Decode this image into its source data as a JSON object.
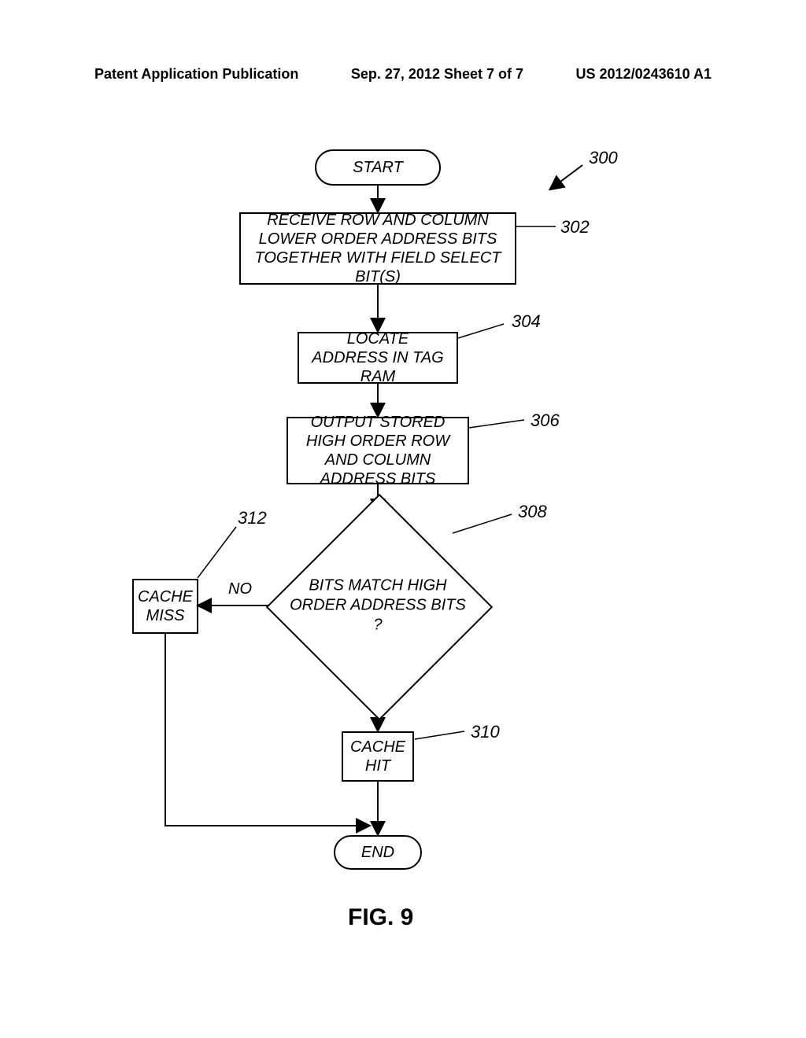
{
  "header": {
    "left": "Patent Application Publication",
    "center": "Sep. 27, 2012  Sheet 7 of 7",
    "right": "US 2012/0243610 A1"
  },
  "figure": {
    "caption": "FIG. 9",
    "ref_main": "300",
    "nodes": {
      "start": "START",
      "step302": "RECEIVE ROW AND COLUMN LOWER ORDER ADDRESS BITS TOGETHER WITH FIELD SELECT BIT(S)",
      "ref302": "302",
      "step304": "LOCATE ADDRESS IN TAG RAM",
      "ref304": "304",
      "step306": "OUTPUT STORED HIGH ORDER ROW AND COLUMN ADDRESS BITS",
      "ref306": "306",
      "decision308": "BITS MATCH HIGH ORDER ADDRESS BITS ?",
      "ref308": "308",
      "step310": "CACHE HIT",
      "ref310": "310",
      "step312": "CACHE MISS",
      "ref312": "312",
      "end": "END"
    },
    "edge_no": "NO"
  }
}
